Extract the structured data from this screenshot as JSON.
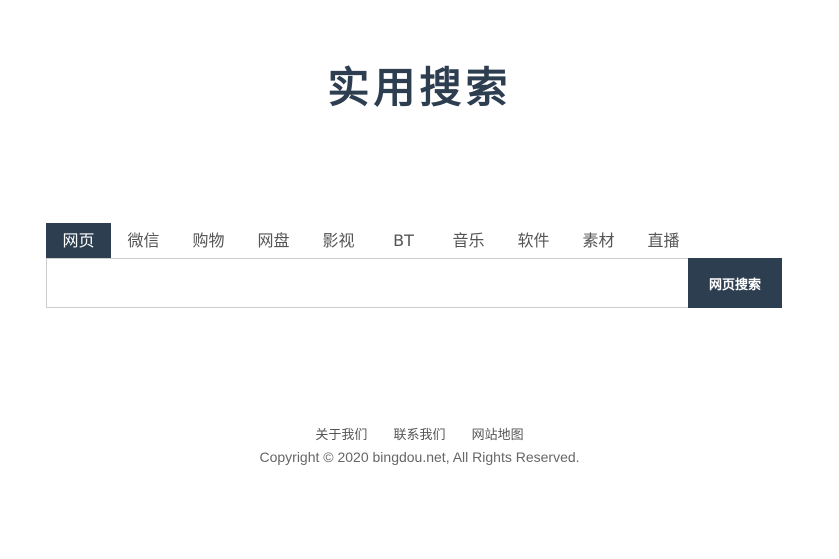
{
  "logo": {
    "text": "实用搜索"
  },
  "tabs": [
    {
      "label": "网页",
      "active": true
    },
    {
      "label": "微信"
    },
    {
      "label": "购物"
    },
    {
      "label": "网盘"
    },
    {
      "label": "影视"
    },
    {
      "label": "BT"
    },
    {
      "label": "音乐"
    },
    {
      "label": "软件"
    },
    {
      "label": "素材"
    },
    {
      "label": "直播"
    }
  ],
  "search": {
    "value": "",
    "button_label": "网页搜索"
  },
  "footer": {
    "links": [
      "关于我们",
      "联系我们",
      "网站地图"
    ],
    "copyright": "Copyright © 2020 bingdou.net, All Rights Reserved."
  },
  "colors": {
    "accent": "#2d3e50",
    "text": "#555555"
  }
}
